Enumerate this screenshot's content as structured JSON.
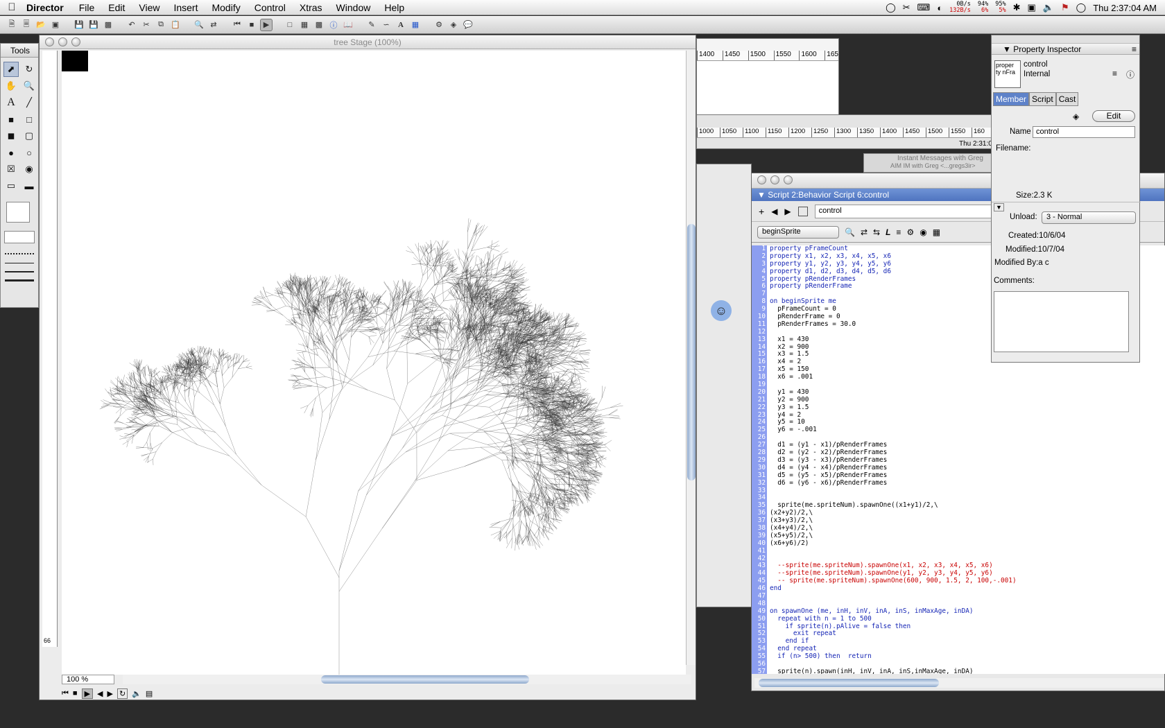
{
  "menubar": {
    "app_name": "Director",
    "items": [
      "File",
      "Edit",
      "View",
      "Insert",
      "Modify",
      "Control",
      "Xtras",
      "Window",
      "Help"
    ],
    "net_up": "0B/s",
    "net_down": "132B/s",
    "cpu1_top": "94%",
    "cpu1_bottom": "6%",
    "cpu2_top": "95%",
    "cpu2_bottom": "5%",
    "clock": "Thu 2:37:04 AM"
  },
  "tools_palette": {
    "title": "Tools"
  },
  "stage": {
    "title": "tree Stage (100%)",
    "zoom": "100 %",
    "ruler_corner": "66",
    "bg_ruler_top": [
      "1400",
      "1450",
      "1500",
      "1550",
      "1600",
      "165"
    ],
    "bg_ruler_bottom": [
      "1000",
      "1050",
      "1100",
      "1150",
      "1200",
      "1250",
      "1300",
      "1350",
      "1400",
      "1450",
      "1500",
      "1550",
      "160"
    ],
    "bg_clock": "Thu 2:31:0",
    "bg_im_title": "Instant Messages with Greg",
    "bg_im_sub": "AIM IM with Greg <...gregs3ir>"
  },
  "script_window": {
    "title": "Script 2:Behavior Script 6:control",
    "name_field": "control",
    "handler_popup": "beginSprite",
    "lines": [
      {
        "n": "1",
        "t": "property pFrameCount",
        "c": "kw"
      },
      {
        "n": "2",
        "t": "property x1, x2, x3, x4, x5, x6",
        "c": "kw"
      },
      {
        "n": "3",
        "t": "property y1, y2, y3, y4, y5, y6",
        "c": "kw"
      },
      {
        "n": "4",
        "t": "property d1, d2, d3, d4, d5, d6",
        "c": "kw"
      },
      {
        "n": "5",
        "t": "property pRenderFrames",
        "c": "kw"
      },
      {
        "n": "6",
        "t": "property pRenderFrame",
        "c": "kw"
      },
      {
        "n": "7",
        "t": "",
        "c": ""
      },
      {
        "n": "8",
        "t": "on beginSprite me",
        "c": "kw"
      },
      {
        "n": "9",
        "t": "  pFrameCount = 0",
        "c": ""
      },
      {
        "n": "10",
        "t": "  pRenderFrame = 0",
        "c": ""
      },
      {
        "n": "11",
        "t": "  pRenderFrames = 30.0",
        "c": ""
      },
      {
        "n": "12",
        "t": "",
        "c": ""
      },
      {
        "n": "13",
        "t": "  x1 = 430",
        "c": ""
      },
      {
        "n": "14",
        "t": "  x2 = 900",
        "c": ""
      },
      {
        "n": "15",
        "t": "  x3 = 1.5",
        "c": ""
      },
      {
        "n": "16",
        "t": "  x4 = 2",
        "c": ""
      },
      {
        "n": "17",
        "t": "  x5 = 150",
        "c": ""
      },
      {
        "n": "18",
        "t": "  x6 = .001",
        "c": ""
      },
      {
        "n": "19",
        "t": "",
        "c": ""
      },
      {
        "n": "20",
        "t": "  y1 = 430",
        "c": ""
      },
      {
        "n": "21",
        "t": "  y2 = 900",
        "c": ""
      },
      {
        "n": "22",
        "t": "  y3 = 1.5",
        "c": ""
      },
      {
        "n": "23",
        "t": "  y4 = 2",
        "c": ""
      },
      {
        "n": "24",
        "t": "  y5 = 10",
        "c": ""
      },
      {
        "n": "25",
        "t": "  y6 = -.001",
        "c": ""
      },
      {
        "n": "26",
        "t": "",
        "c": ""
      },
      {
        "n": "27",
        "t": "  d1 = (y1 - x1)/pRenderFrames",
        "c": ""
      },
      {
        "n": "28",
        "t": "  d2 = (y2 - x2)/pRenderFrames",
        "c": ""
      },
      {
        "n": "29",
        "t": "  d3 = (y3 - x3)/pRenderFrames",
        "c": ""
      },
      {
        "n": "30",
        "t": "  d4 = (y4 - x4)/pRenderFrames",
        "c": ""
      },
      {
        "n": "31",
        "t": "  d5 = (y5 - x5)/pRenderFrames",
        "c": ""
      },
      {
        "n": "32",
        "t": "  d6 = (y6 - x6)/pRenderFrames",
        "c": ""
      },
      {
        "n": "33",
        "t": "",
        "c": ""
      },
      {
        "n": "34",
        "t": "",
        "c": ""
      },
      {
        "n": "35",
        "t": "  sprite(me.spriteNum).spawnOne((x1+y1)/2,\\",
        "c": ""
      },
      {
        "n": "36",
        "t": "(x2+y2)/2,\\",
        "c": ""
      },
      {
        "n": "37",
        "t": "(x3+y3)/2,\\",
        "c": ""
      },
      {
        "n": "38",
        "t": "(x4+y4)/2,\\",
        "c": ""
      },
      {
        "n": "39",
        "t": "(x5+y5)/2,\\",
        "c": ""
      },
      {
        "n": "40",
        "t": "(x6+y6)/2)",
        "c": ""
      },
      {
        "n": "41",
        "t": "",
        "c": ""
      },
      {
        "n": "42",
        "t": "",
        "c": ""
      },
      {
        "n": "43",
        "t": "  --sprite(me.spriteNum).spawnOne(x1, x2, x3, x4, x5, x6)",
        "c": "cm"
      },
      {
        "n": "44",
        "t": "  --sprite(me.spriteNum).spawnOne(y1, y2, y3, y4, y5, y6)",
        "c": "cm"
      },
      {
        "n": "45",
        "t": "  -- sprite(me.spriteNum).spawnOne(600, 900, 1.5, 2, 100,-.001)",
        "c": "cm"
      },
      {
        "n": "46",
        "t": "end",
        "c": "kw"
      },
      {
        "n": "47",
        "t": "",
        "c": ""
      },
      {
        "n": "48",
        "t": "",
        "c": ""
      },
      {
        "n": "49",
        "t": "on spawnOne (me, inH, inV, inA, inS, inMaxAge, inDA)",
        "c": "kw"
      },
      {
        "n": "50",
        "t": "  repeat with n = 1 to 500",
        "c": "kw"
      },
      {
        "n": "51",
        "t": "    if sprite(n).pAlive = false then",
        "c": "kw"
      },
      {
        "n": "52",
        "t": "      exit repeat",
        "c": "kw"
      },
      {
        "n": "53",
        "t": "    end if",
        "c": "kw"
      },
      {
        "n": "54",
        "t": "  end repeat",
        "c": "kw"
      },
      {
        "n": "55",
        "t": "  if (n> 500) then  return",
        "c": "kw"
      },
      {
        "n": "56",
        "t": "",
        "c": ""
      },
      {
        "n": "57",
        "t": "  sprite(n).spawn(inH, inV, inA, inS,inMaxAge, inDA)",
        "c": ""
      }
    ]
  },
  "property_inspector": {
    "title": "Property Inspector",
    "thumb_text": "proper ty nFra",
    "member_name": "control",
    "member_type": "Internal",
    "tabs": [
      "Member",
      "Script",
      "Cast"
    ],
    "edit_label": "Edit",
    "name_label": "Name",
    "name_value": "control",
    "filename_label": "Filename:",
    "size_label": "Size:",
    "size_value": "2.3 K",
    "unload_label": "Unload:",
    "unload_value": "3 - Normal",
    "created_label": "Created:",
    "created_value": "10/6/04",
    "modified_label": "Modified:",
    "modified_value": "10/7/04",
    "modified_by_label": "Modified By:",
    "modified_by_value": "a c",
    "comments_label": "Comments:"
  },
  "colors": {
    "gutter": "#8c9ef0",
    "keyword": "#1525b5",
    "comment": "#c80000",
    "desktop": "#2b2b2b"
  }
}
